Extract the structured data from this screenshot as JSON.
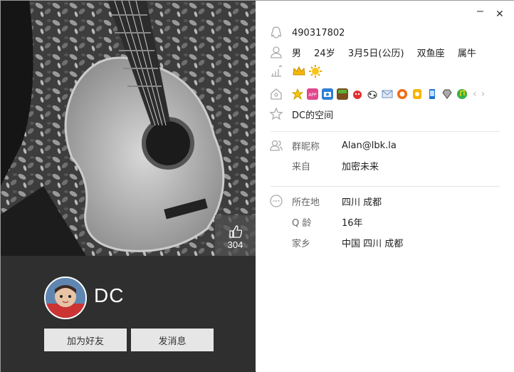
{
  "profile": {
    "qq_number": "490317802",
    "gender": "男",
    "age": "24岁",
    "birthday": "3月5日(公历)",
    "constellation": "双鱼座",
    "zodiac": "属牛",
    "space_label": "DC的空间",
    "nickname": "DC",
    "likes": "304"
  },
  "group": {
    "nick_label": "群昵称",
    "nick_value": "Alan@lbk.la",
    "from_label": "来自",
    "from_value": "加密未来"
  },
  "details": {
    "location_label": "所在地",
    "location_value": "四川 成都",
    "qage_label": "Q 龄",
    "qage_value": "16年",
    "hometown_label": "家乡",
    "hometown_value": "中国 四川 成都"
  },
  "buttons": {
    "add_friend": "加为好友",
    "send_message": "发消息"
  },
  "window": {
    "minimize": "–",
    "close": "✕"
  },
  "icons": {
    "qq": "qq-penguin-icon",
    "person": "person-icon",
    "level": "level-chart-icon",
    "vip": "vip-house-icon",
    "star": "star-outline-icon",
    "group": "group-people-icon",
    "more": "more-dots-icon"
  },
  "badges": [
    "yellow-star",
    "app",
    "camera",
    "green-box",
    "red-fruit",
    "cow",
    "mail",
    "orange-circle",
    "yellow-phone",
    "blue-phone",
    "diamond",
    "music-green"
  ]
}
